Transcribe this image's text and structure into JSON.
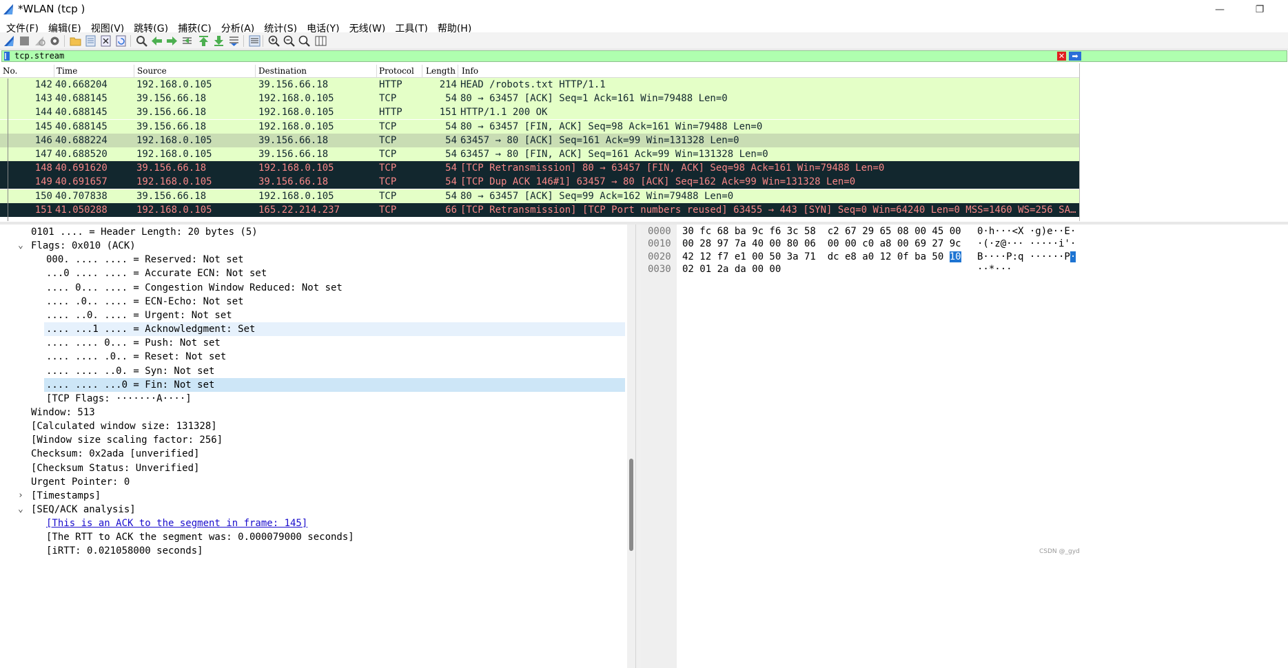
{
  "window": {
    "title": "*WLAN (tcp )",
    "minimize": "—",
    "restore": "❐"
  },
  "menu": [
    "文件(F)",
    "编辑(E)",
    "视图(V)",
    "跳转(G)",
    "捕获(C)",
    "分析(A)",
    "统计(S)",
    "电话(Y)",
    "无线(W)",
    "工具(T)",
    "帮助(H)"
  ],
  "toolbar": {
    "icons": [
      "shark-fin-start-icon",
      "stop-icon",
      "restart-icon",
      "options-gear-icon",
      "open-folder-icon",
      "save-file-icon",
      "close-file-icon",
      "reload-icon",
      "find-icon",
      "go-back-icon",
      "go-forward-icon",
      "go-to-packet-icon",
      "first-packet-icon",
      "last-packet-icon",
      "autoscroll-icon",
      "colorize-icon",
      "zoom-in-icon",
      "zoom-out-icon",
      "normal-size-icon",
      "resize-columns-icon"
    ]
  },
  "filter": {
    "value": "tcp.stream",
    "color": "#afffaf"
  },
  "packet_list": {
    "columns": [
      "No.",
      "Time",
      "Source",
      "Destination",
      "Protocol",
      "Length",
      "Info"
    ],
    "rows": [
      {
        "no": "142",
        "time": "40.668204",
        "src": "192.168.0.105",
        "dst": "39.156.66.18",
        "proto": "HTTP",
        "len": "214",
        "info": "HEAD /robots.txt HTTP/1.1",
        "style": "green"
      },
      {
        "no": "143",
        "time": "40.688145",
        "src": "39.156.66.18",
        "dst": "192.168.0.105",
        "proto": "TCP",
        "len": "54",
        "info": "80 → 63457 [ACK] Seq=1 Ack=161 Win=79488 Len=0",
        "style": "green"
      },
      {
        "no": "144",
        "time": "40.688145",
        "src": "39.156.66.18",
        "dst": "192.168.0.105",
        "proto": "HTTP",
        "len": "151",
        "info": "HTTP/1.1 200 OK",
        "style": "green"
      },
      {
        "no": "145",
        "time": "40.688145",
        "src": "39.156.66.18",
        "dst": "192.168.0.105",
        "proto": "TCP",
        "len": "54",
        "info": "80 → 63457 [FIN, ACK] Seq=98 Ack=161 Win=79488 Len=0",
        "style": "green"
      },
      {
        "no": "146",
        "time": "40.688224",
        "src": "192.168.0.105",
        "dst": "39.156.66.18",
        "proto": "TCP",
        "len": "54",
        "info": "63457 → 80 [ACK] Seq=161 Ack=99 Win=131328 Len=0",
        "style": "sel"
      },
      {
        "no": "147",
        "time": "40.688520",
        "src": "192.168.0.105",
        "dst": "39.156.66.18",
        "proto": "TCP",
        "len": "54",
        "info": "63457 → 80 [FIN, ACK] Seq=161 Ack=99 Win=131328 Len=0",
        "style": "green"
      },
      {
        "no": "148",
        "time": "40.691620",
        "src": "39.156.66.18",
        "dst": "192.168.0.105",
        "proto": "TCP",
        "len": "54",
        "info": "[TCP Retransmission] 80 → 63457 [FIN, ACK] Seq=98 Ack=161 Win=79488 Len=0",
        "style": "dark"
      },
      {
        "no": "149",
        "time": "40.691657",
        "src": "192.168.0.105",
        "dst": "39.156.66.18",
        "proto": "TCP",
        "len": "54",
        "info": "[TCP Dup ACK 146#1] 63457 → 80 [ACK] Seq=162 Ack=99 Win=131328 Len=0",
        "style": "dark"
      },
      {
        "no": "150",
        "time": "40.707838",
        "src": "39.156.66.18",
        "dst": "192.168.0.105",
        "proto": "TCP",
        "len": "54",
        "info": "80 → 63457 [ACK] Seq=99 Ack=162 Win=79488 Len=0",
        "style": "green"
      },
      {
        "no": "151",
        "time": "41.050288",
        "src": "192.168.0.105",
        "dst": "165.22.214.237",
        "proto": "TCP",
        "len": "66",
        "info": "[TCP Retransmission] [TCP Port numbers reused] 63455 → 443 [SYN] Seq=0 Win=64240 Len=0 MSS=1460 WS=256 SA…",
        "style": "dark"
      }
    ]
  },
  "details": {
    "lines": [
      {
        "text": "0101 .... = Header Length: 20 bytes (5)",
        "indent": 1,
        "arrow": "",
        "hl": "",
        "link": false
      },
      {
        "text": "Flags: 0x010 (ACK)",
        "indent": 1,
        "arrow": "⌄",
        "hl": "",
        "link": false
      },
      {
        "text": "000. .... .... = Reserved: Not set",
        "indent": 2,
        "arrow": "",
        "hl": "",
        "link": false
      },
      {
        "text": "...0 .... .... = Accurate ECN: Not set",
        "indent": 2,
        "arrow": "",
        "hl": "",
        "link": false
      },
      {
        "text": ".... 0... .... = Congestion Window Reduced: Not set",
        "indent": 2,
        "arrow": "",
        "hl": "",
        "link": false
      },
      {
        "text": ".... .0.. .... = ECN-Echo: Not set",
        "indent": 2,
        "arrow": "",
        "hl": "",
        "link": false
      },
      {
        "text": ".... ..0. .... = Urgent: Not set",
        "indent": 2,
        "arrow": "",
        "hl": "",
        "link": false
      },
      {
        "text": ".... ...1 .... = Acknowledgment: Set",
        "indent": 2,
        "arrow": "",
        "hl": "hl1",
        "link": false
      },
      {
        "text": ".... .... 0... = Push: Not set",
        "indent": 2,
        "arrow": "",
        "hl": "",
        "link": false
      },
      {
        "text": ".... .... .0.. = Reset: Not set",
        "indent": 2,
        "arrow": "",
        "hl": "",
        "link": false
      },
      {
        "text": ".... .... ..0. = Syn: Not set",
        "indent": 2,
        "arrow": "",
        "hl": "",
        "link": false
      },
      {
        "text": ".... .... ...0 = Fin: Not set",
        "indent": 2,
        "arrow": "",
        "hl": "hl2",
        "link": false
      },
      {
        "text": "[TCP Flags: ·······A····]",
        "indent": 2,
        "arrow": "",
        "hl": "",
        "link": false
      },
      {
        "text": "Window: 513",
        "indent": 1,
        "arrow": "",
        "hl": "",
        "link": false
      },
      {
        "text": "[Calculated window size: 131328]",
        "indent": 1,
        "arrow": "",
        "hl": "",
        "link": false
      },
      {
        "text": "[Window size scaling factor: 256]",
        "indent": 1,
        "arrow": "",
        "hl": "",
        "link": false
      },
      {
        "text": "Checksum: 0x2ada [unverified]",
        "indent": 1,
        "arrow": "",
        "hl": "",
        "link": false
      },
      {
        "text": "[Checksum Status: Unverified]",
        "indent": 1,
        "arrow": "",
        "hl": "",
        "link": false
      },
      {
        "text": "Urgent Pointer: 0",
        "indent": 1,
        "arrow": "",
        "hl": "",
        "link": false
      },
      {
        "text": "[Timestamps]",
        "indent": 1,
        "arrow": "›",
        "hl": "",
        "link": false
      },
      {
        "text": "[SEQ/ACK analysis]",
        "indent": 1,
        "arrow": "⌄",
        "hl": "",
        "link": false
      },
      {
        "text": "[This is an ACK to the segment in frame: 145]",
        "indent": 2,
        "arrow": "",
        "hl": "",
        "link": true
      },
      {
        "text": "[The RTT to ACK the segment was: 0.000079000 seconds]",
        "indent": 2,
        "arrow": "",
        "hl": "",
        "link": false
      },
      {
        "text": "[iRTT: 0.021058000 seconds]",
        "indent": 2,
        "arrow": "",
        "hl": "",
        "link": false
      }
    ]
  },
  "bytes": {
    "rows": [
      {
        "offset": "0000",
        "hex": "30 fc 68 ba 9c f6 3c 58  c2 67 29 65 08 00 45 00",
        "hex_sel": "",
        "ascii": "0·h···<X ·g)e··E·",
        "ascii_sel": ""
      },
      {
        "offset": "0010",
        "hex": "00 28 97 7a 40 00 80 06  00 00 c0 a8 00 69 27 9c",
        "hex_sel": "",
        "ascii": "·(·z@··· ·····i'·",
        "ascii_sel": ""
      },
      {
        "offset": "0020",
        "hex": "42 12 f7 e1 00 50 3a 71  dc e8 a0 12 0f ba 50 ",
        "hex_sel": "10",
        "ascii": "B····P:q ······P",
        "ascii_sel": "·"
      },
      {
        "offset": "0030",
        "hex": "02 01 2a da 00 00",
        "hex_sel": "",
        "ascii": "··*···",
        "ascii_sel": ""
      }
    ]
  },
  "watermark": "CSDN @_gyd"
}
